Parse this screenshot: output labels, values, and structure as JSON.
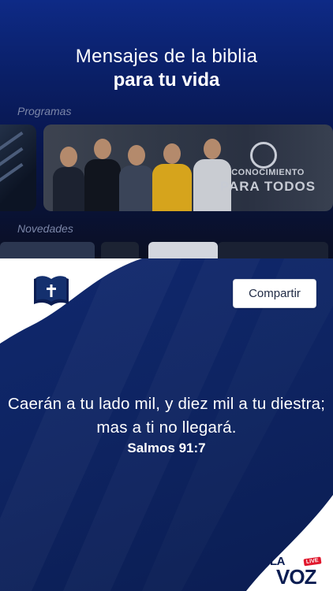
{
  "headline": {
    "line1": "Mensajes de la biblia",
    "line2": "para tu vida"
  },
  "sections": {
    "programas": "Programas",
    "novedades": "Novedades"
  },
  "featured_card": {
    "title_line1": "CONOCIMIENTO",
    "title_line2": "PARA TODOS"
  },
  "verse_card": {
    "share_label": "Compartir",
    "verse_text": "Caerán a tu lado mil, y diez mil a tu diestra; mas a ti no llegará.",
    "reference": "Salmos 91:7",
    "icon": "bible-cross-icon"
  },
  "brand": {
    "logo_la": "LA",
    "logo_voz": "VOZ",
    "logo_badge": "LIVE"
  },
  "colors": {
    "navy": "#0b1d52",
    "royal_blue": "#0e2a86",
    "white": "#ffffff",
    "live_red": "#e0182d"
  }
}
